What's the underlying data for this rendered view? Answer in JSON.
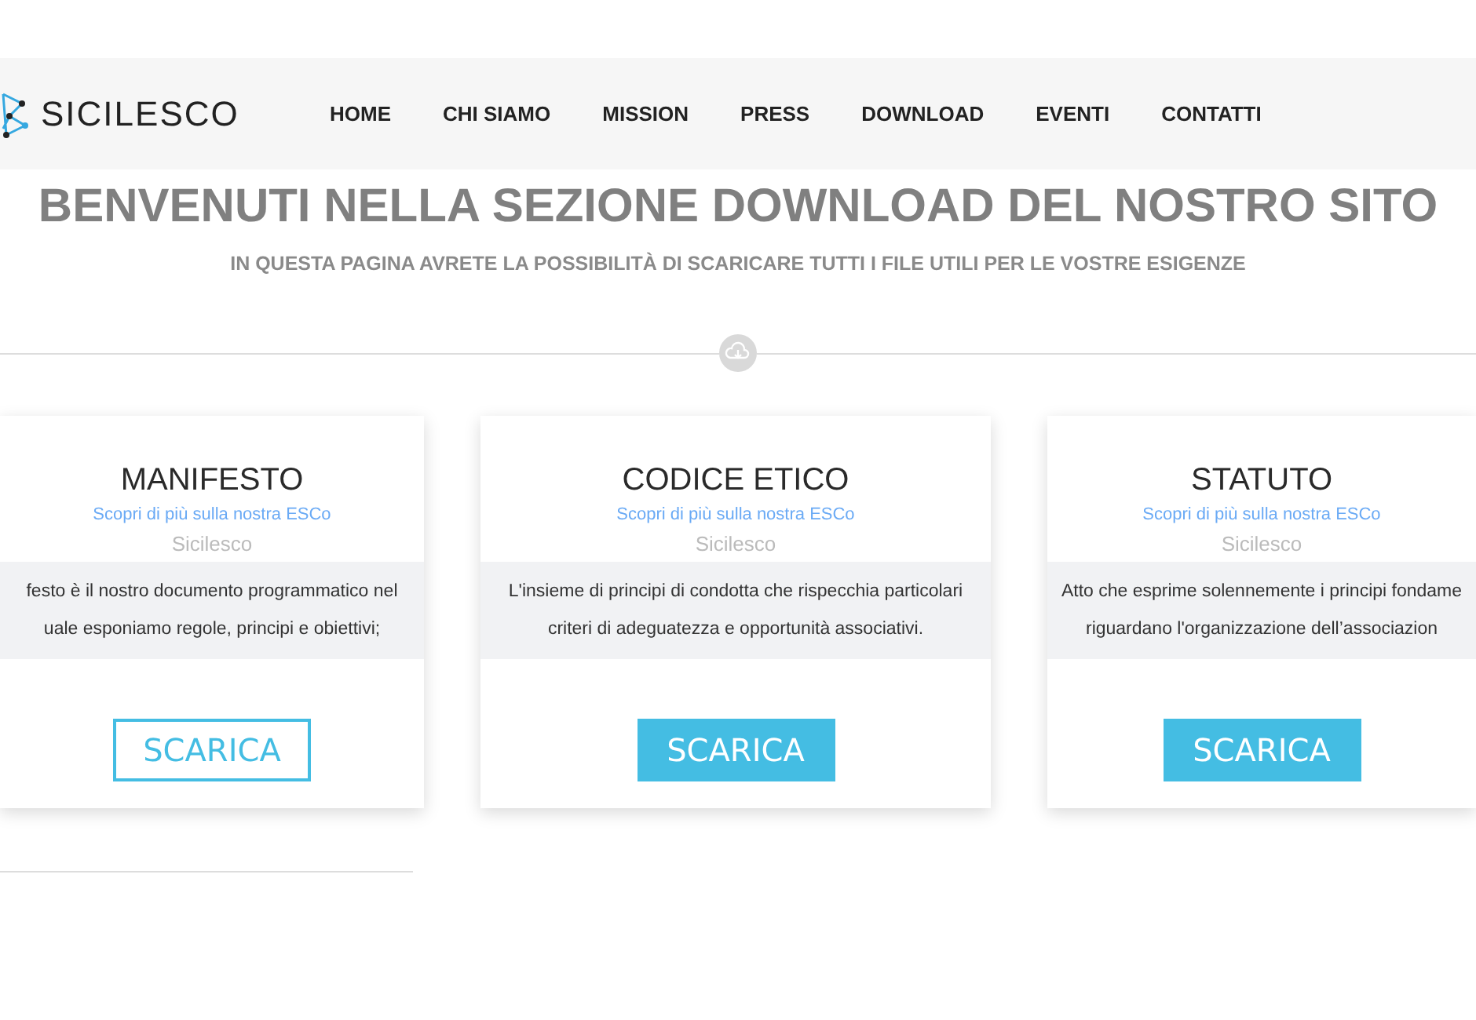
{
  "header": {
    "logo": "SICILESCO",
    "nav": [
      {
        "label": "HOME"
      },
      {
        "label": "CHI SIAMO"
      },
      {
        "label": "MISSION"
      },
      {
        "label": "PRESS"
      },
      {
        "label": "DOWNLOAD"
      },
      {
        "label": "EVENTI"
      },
      {
        "label": "CONTATTI"
      }
    ]
  },
  "intro": {
    "title": "BENVENUTI NELLA SEZIONE DOWNLOAD DEL NOSTRO SITO",
    "subtitle": "IN QUESTA PAGINA AVRETE LA POSSIBILITÀ DI SCARICARE TUTTI I FILE UTILI PER LE VOSTRE ESIGENZE"
  },
  "cards": [
    {
      "title": "MANIFESTO",
      "link": "Scopri di più sulla nostra ESCo",
      "brand": "Sicilesco",
      "lines": [
        "festo è il nostro documento programmatico nel",
        "uale esponiamo regole, principi e obiettivi;"
      ],
      "button": {
        "label": "SCARICA",
        "kind": "outline"
      }
    },
    {
      "title": "CODICE ETICO",
      "link": "Scopri di più sulla nostra ESCo",
      "brand": "Sicilesco",
      "lines": [
        "L'insieme di principi di condotta che rispecchia particolari",
        "criteri di adeguatezza e opportunità associativi."
      ],
      "button": {
        "label": "SCARICA",
        "kind": "filled"
      }
    },
    {
      "title": "STATUTO",
      "link": "Scopri di più sulla nostra ESCo",
      "brand": "Sicilesco",
      "lines": [
        "Atto che esprime solennemente i principi fondame",
        "riguardano l'organizzazione dell’associazion"
      ],
      "button": {
        "label": "SCARICA",
        "kind": "filled"
      }
    }
  ]
}
